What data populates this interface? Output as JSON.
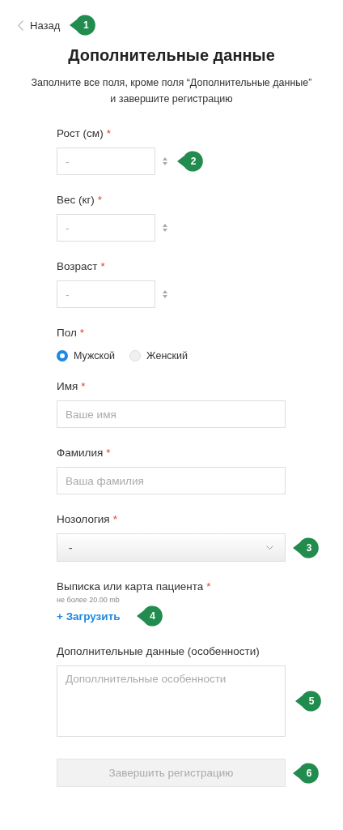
{
  "back": {
    "label": "Назад",
    "callout": "1"
  },
  "title": "Дополнительные данные",
  "subtitle": "Заполните все поля, кроме поля “Дополнительные данные” и завершите регистрацию",
  "fields": [
    {
      "kind": "number",
      "label": "Рост (см)",
      "mark": "*",
      "placeholder": "-",
      "callout": "2"
    },
    {
      "kind": "number",
      "label": "Вес (кг)",
      "mark": "*",
      "placeholder": "-"
    },
    {
      "kind": "number",
      "label": "Возраст",
      "mark": "*",
      "placeholder": "-"
    },
    {
      "kind": "radio",
      "label": "Пол",
      "mark": "*",
      "options": [
        {
          "label": "Мужской",
          "selected": true
        },
        {
          "label": "Женский",
          "selected": false
        }
      ]
    },
    {
      "kind": "text",
      "label": "Имя",
      "mark": "*",
      "placeholder": "Ваше имя"
    },
    {
      "kind": "text",
      "label": "Фамилия",
      "mark": "*",
      "placeholder": "Ваша фамилия"
    },
    {
      "kind": "select",
      "label": "Нозология",
      "mark": "*",
      "value": "-",
      "callout": "3"
    },
    {
      "kind": "upload",
      "label": "Выписка или карта пациента",
      "mark": "*",
      "hint": "не более 20.00 mb",
      "action": "+ Загрузить",
      "callout": "4"
    },
    {
      "kind": "textarea",
      "label": "Дополнительные данные (особенности)",
      "placeholder": "Дополлнительные особенности",
      "callout": "5"
    }
  ],
  "submit": {
    "label": "Завершить регистрацию",
    "disabled": true,
    "callout": "6"
  }
}
